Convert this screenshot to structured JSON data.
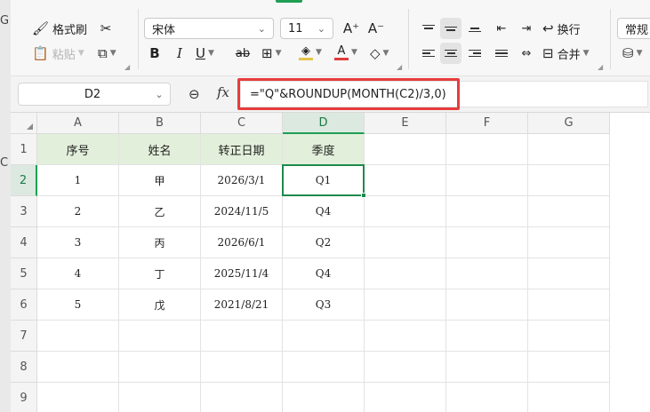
{
  "ribbon": {
    "format_painter": "格式刷",
    "paste": "粘贴",
    "font_name": "宋体",
    "font_size": "11",
    "wrap_text": "换行",
    "merge": "合并",
    "number_format": "常规"
  },
  "formula_bar": {
    "cell_ref": "D2",
    "fx": "fx",
    "formula": "=\"Q\"&ROUNDUP(MONTH(C2)/3,0)"
  },
  "sheet": {
    "columns": [
      "A",
      "B",
      "C",
      "D",
      "E",
      "F",
      "G"
    ],
    "rows": [
      "1",
      "2",
      "3",
      "4",
      "5",
      "6",
      "7",
      "8",
      "9"
    ],
    "headers": [
      "序号",
      "姓名",
      "转正日期",
      "季度"
    ],
    "data": [
      [
        "1",
        "甲",
        "2026/3/1",
        "Q1"
      ],
      [
        "2",
        "乙",
        "2024/11/5",
        "Q4"
      ],
      [
        "3",
        "丙",
        "2026/6/1",
        "Q2"
      ],
      [
        "4",
        "丁",
        "2025/11/4",
        "Q4"
      ],
      [
        "5",
        "戊",
        "2021/8/21",
        "Q3"
      ]
    ],
    "active_cell": "D2"
  },
  "colors": {
    "accent": "#1e9f52",
    "header_fill": "#e2efda",
    "annotation": "#e63c3c",
    "font_color_bar": "#e03c3c"
  },
  "icons": [
    "format-painter-icon",
    "scissors-icon",
    "paste-icon",
    "copy-icon",
    "font-grow-icon",
    "font-shrink-icon",
    "bold-icon",
    "italic-icon",
    "underline-icon",
    "strikethrough-icon",
    "border-icon",
    "fill-color-icon",
    "font-color-icon",
    "eraser-icon",
    "align-top-icon",
    "align-middle-icon",
    "align-bottom-icon",
    "indent-icon",
    "wrap-icon",
    "align-left-icon",
    "align-center-icon",
    "align-right-icon",
    "justify-icon",
    "distribute-icon",
    "merge-icon",
    "zoom-icon",
    "fx-icon"
  ]
}
